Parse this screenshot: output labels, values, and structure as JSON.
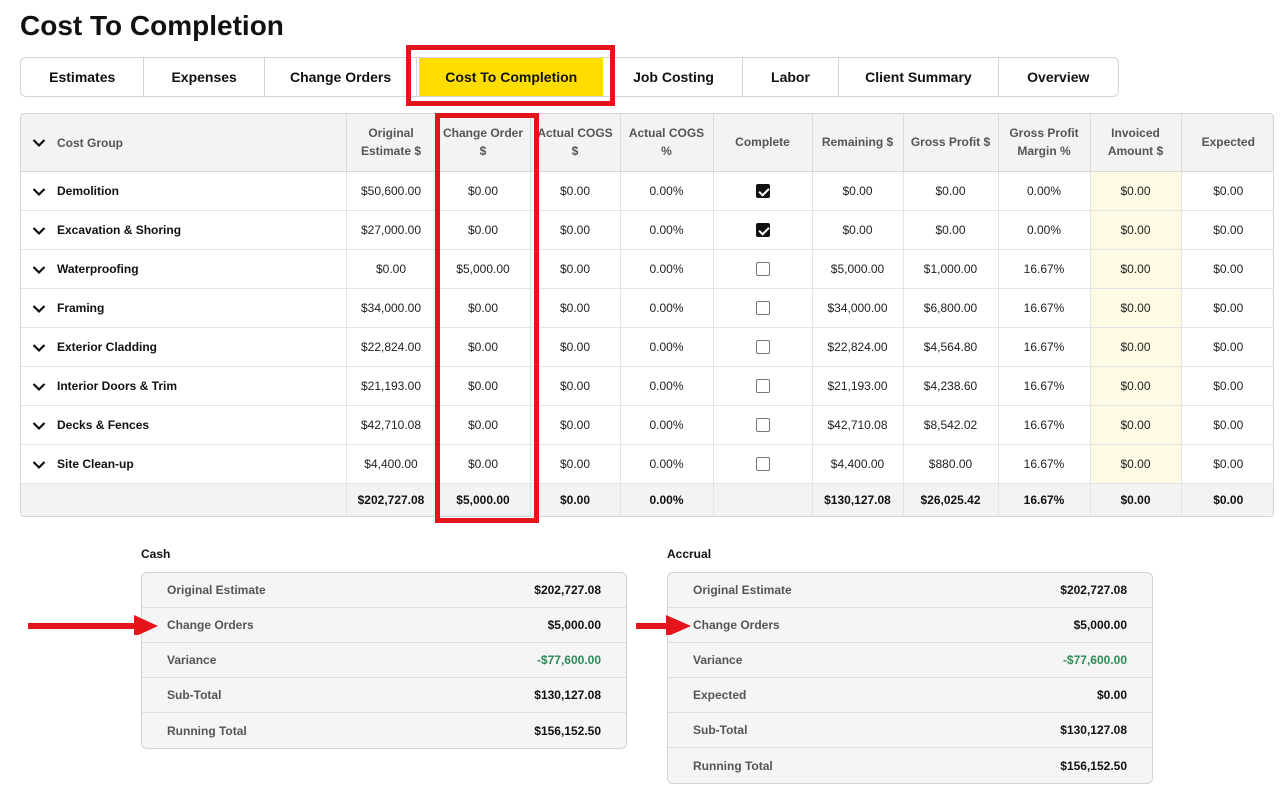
{
  "page": {
    "title": "Cost To Completion"
  },
  "tabs": [
    {
      "label": "Estimates",
      "width": 124
    },
    {
      "label": "Expenses",
      "width": 121
    },
    {
      "label": "Change Orders",
      "width": 153
    },
    {
      "label": "Cost To Completion",
      "width": 185,
      "active": true
    },
    {
      "label": "Job Costing",
      "width": 138
    },
    {
      "label": "Labor",
      "width": 97
    },
    {
      "label": "Client Summary",
      "width": 160
    },
    {
      "label": "Overview",
      "width": 120
    }
  ],
  "table": {
    "headers": [
      "Cost Group",
      "Original Estimate $",
      "Change Order $",
      "Actual COGS $",
      "Actual COGS %",
      "Complete",
      "Remaining $",
      "Gross Profit $",
      "Gross Profit Margin %",
      "Invoiced Amount $",
      "Expected"
    ],
    "rows": [
      {
        "name": "Demolition",
        "original": "$50,600.00",
        "change": "$0.00",
        "cogs": "$0.00",
        "cogs_pct": "0.00%",
        "complete": true,
        "remaining": "$0.00",
        "gross": "$0.00",
        "margin": "0.00%",
        "invoiced": "$0.00",
        "expected": "$0.00"
      },
      {
        "name": "Excavation & Shoring",
        "original": "$27,000.00",
        "change": "$0.00",
        "cogs": "$0.00",
        "cogs_pct": "0.00%",
        "complete": true,
        "remaining": "$0.00",
        "gross": "$0.00",
        "margin": "0.00%",
        "invoiced": "$0.00",
        "expected": "$0.00"
      },
      {
        "name": "Waterproofing",
        "original": "$0.00",
        "change": "$5,000.00",
        "cogs": "$0.00",
        "cogs_pct": "0.00%",
        "complete": false,
        "remaining": "$5,000.00",
        "gross": "$1,000.00",
        "margin": "16.67%",
        "invoiced": "$0.00",
        "expected": "$0.00"
      },
      {
        "name": "Framing",
        "original": "$34,000.00",
        "change": "$0.00",
        "cogs": "$0.00",
        "cogs_pct": "0.00%",
        "complete": false,
        "remaining": "$34,000.00",
        "gross": "$6,800.00",
        "margin": "16.67%",
        "invoiced": "$0.00",
        "expected": "$0.00"
      },
      {
        "name": "Exterior Cladding",
        "original": "$22,824.00",
        "change": "$0.00",
        "cogs": "$0.00",
        "cogs_pct": "0.00%",
        "complete": false,
        "remaining": "$22,824.00",
        "gross": "$4,564.80",
        "margin": "16.67%",
        "invoiced": "$0.00",
        "expected": "$0.00"
      },
      {
        "name": "Interior Doors & Trim",
        "original": "$21,193.00",
        "change": "$0.00",
        "cogs": "$0.00",
        "cogs_pct": "0.00%",
        "complete": false,
        "remaining": "$21,193.00",
        "gross": "$4,238.60",
        "margin": "16.67%",
        "invoiced": "$0.00",
        "expected": "$0.00"
      },
      {
        "name": "Decks & Fences",
        "original": "$42,710.08",
        "change": "$0.00",
        "cogs": "$0.00",
        "cogs_pct": "0.00%",
        "complete": false,
        "remaining": "$42,710.08",
        "gross": "$8,542.02",
        "margin": "16.67%",
        "invoiced": "$0.00",
        "expected": "$0.00"
      },
      {
        "name": "Site Clean-up",
        "original": "$4,400.00",
        "change": "$0.00",
        "cogs": "$0.00",
        "cogs_pct": "0.00%",
        "complete": false,
        "remaining": "$4,400.00",
        "gross": "$880.00",
        "margin": "16.67%",
        "invoiced": "$0.00",
        "expected": "$0.00"
      }
    ],
    "totals": {
      "original": "$202,727.08",
      "change": "$5,000.00",
      "cogs": "$0.00",
      "cogs_pct": "0.00%",
      "remaining": "$130,127.08",
      "gross": "$26,025.42",
      "margin": "16.67%",
      "invoiced": "$0.00",
      "expected": "$0.00"
    }
  },
  "cash": {
    "title": "Cash",
    "rows": [
      {
        "label": "Original Estimate",
        "value": "$202,727.08"
      },
      {
        "label": "Change Orders",
        "value": "$5,000.00"
      },
      {
        "label": "Variance",
        "value": "-$77,600.00",
        "tone": "green"
      },
      {
        "label": "Sub-Total",
        "value": "$130,127.08"
      },
      {
        "label": "Running Total",
        "value": "$156,152.50"
      }
    ]
  },
  "accrual": {
    "title": "Accrual",
    "rows": [
      {
        "label": "Original Estimate",
        "value": "$202,727.08"
      },
      {
        "label": "Change Orders",
        "value": "$5,000.00"
      },
      {
        "label": "Variance",
        "value": "-$77,600.00",
        "tone": "green"
      },
      {
        "label": "Expected",
        "value": "$0.00"
      },
      {
        "label": "Sub-Total",
        "value": "$130,127.08"
      },
      {
        "label": "Running Total",
        "value": "$156,152.50"
      }
    ]
  },
  "colors": {
    "active_tab": "#ffdd00",
    "highlight": "#e5141b",
    "positive": "#2e8b57",
    "invoiced_bg": "#fefae4"
  }
}
